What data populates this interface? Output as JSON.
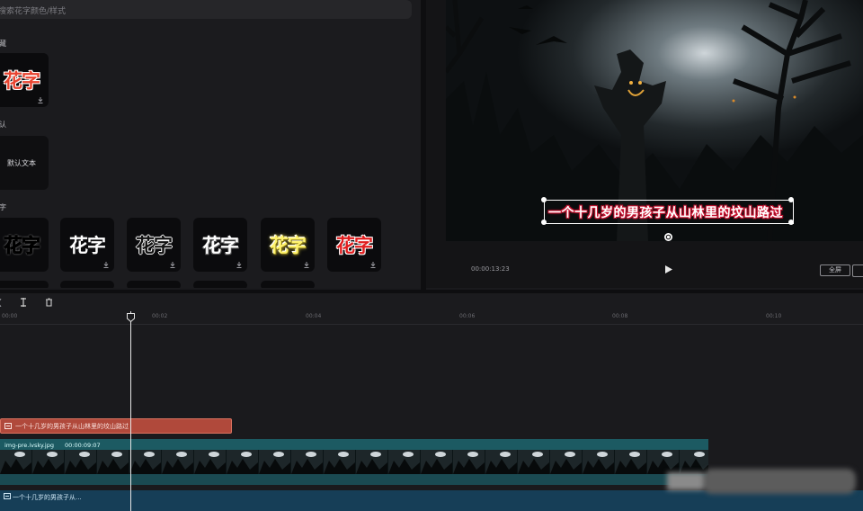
{
  "search": {
    "placeholder": "搜索花字颜色/样式"
  },
  "sections": {
    "favorites": {
      "label": "藏"
    },
    "default": {
      "label": "认",
      "tile_label": "默认文本"
    },
    "styles": {
      "label": "字"
    }
  },
  "favorite_tile": {
    "text": "花字",
    "color": "#e8432f"
  },
  "style_tiles": [
    {
      "text": "花字",
      "style": "outline-white"
    },
    {
      "text": "花字",
      "style": "solid-white"
    },
    {
      "text": "花字",
      "style": "thin-white"
    },
    {
      "text": "花字",
      "style": "outline-white-bold"
    },
    {
      "text": "花字",
      "style": "yellow-glow"
    },
    {
      "text": "花字",
      "style": "red-white"
    }
  ],
  "preview": {
    "subtitle": "一个十几岁的男孩子从山林里的坟山路过",
    "time_readout": "00:00:13:23",
    "play_icon": "play-icon",
    "fullscreen_label": "全屏"
  },
  "toolbar": {
    "icons": [
      "split-icon",
      "delete-icon"
    ]
  },
  "ruler": {
    "labels": [
      "00:00",
      "00:02",
      "00:04",
      "00:06",
      "00:08",
      "00:10"
    ]
  },
  "tracks": {
    "text_clip": "一个十几岁的男孩子从山林里的坟山路过",
    "video_clip": {
      "name": "img-pre.ivsky.jpg",
      "duration": "00:00:09:07"
    },
    "audio_clip": "一个十几岁的男孩子从..."
  },
  "colors": {
    "accent_red": "#b0493b",
    "video_teal": "#1c5a62",
    "audio_blue": "#163e57"
  }
}
